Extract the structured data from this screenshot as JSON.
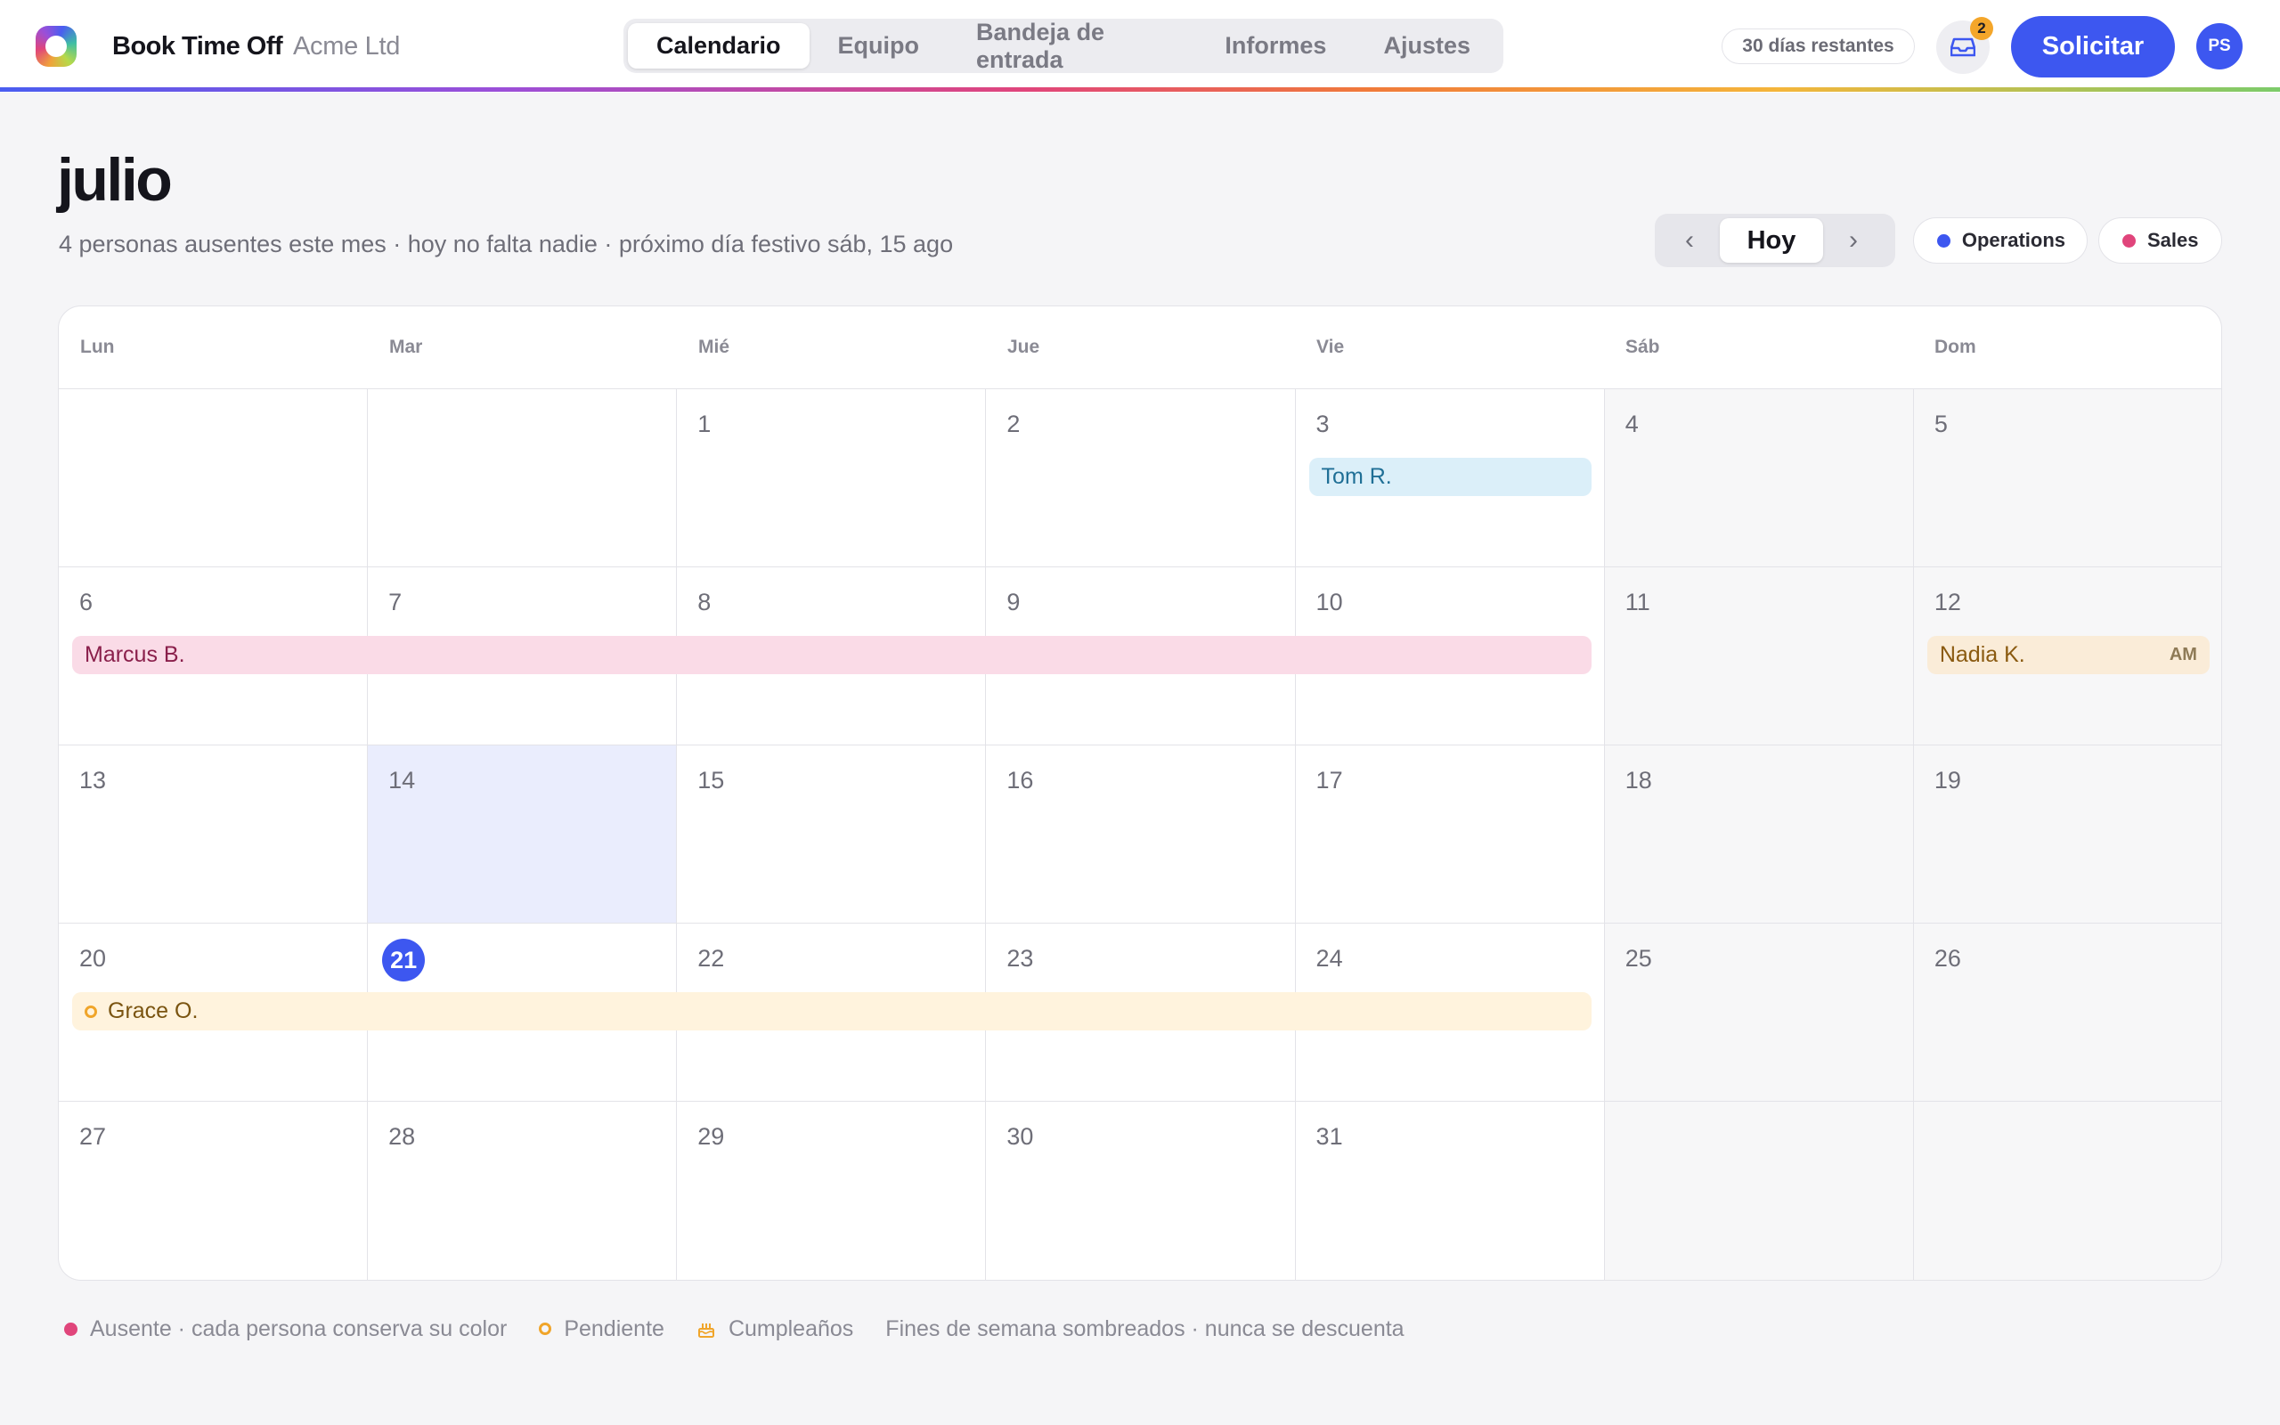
{
  "header": {
    "app_name": "Book Time Off",
    "company": "Acme Ltd",
    "tabs": [
      {
        "label": "Calendario",
        "active": true
      },
      {
        "label": "Equipo",
        "active": false
      },
      {
        "label": "Bandeja de entrada",
        "active": false
      },
      {
        "label": "Informes",
        "active": false
      },
      {
        "label": "Ajustes",
        "active": false
      }
    ],
    "days_left": "30 días restantes",
    "inbox_count": "2",
    "request_label": "Solicitar",
    "avatar_initials": "PS"
  },
  "page": {
    "month": "julio",
    "summary": "4 personas ausentes este mes · hoy no falta nadie · próximo día festivo sáb, 15 ago",
    "prev_icon": "‹",
    "next_icon": "›",
    "today_label": "Hoy",
    "teams": [
      {
        "label": "Operations",
        "color": "#3d57f0"
      },
      {
        "label": "Sales",
        "color": "#e0457b"
      }
    ]
  },
  "calendar": {
    "weekdays": [
      "Lun",
      "Mar",
      "Mié",
      "Jue",
      "Vie",
      "Sáb",
      "Dom"
    ],
    "weeks": [
      [
        "",
        "",
        "1",
        "2",
        "3",
        "4",
        "5"
      ],
      [
        "6",
        "7",
        "8",
        "9",
        "10",
        "11",
        "12"
      ],
      [
        "13",
        "14",
        "15",
        "16",
        "17",
        "18",
        "19"
      ],
      [
        "20",
        "21",
        "22",
        "23",
        "24",
        "25",
        "26"
      ],
      [
        "27",
        "28",
        "29",
        "30",
        "31",
        "",
        ""
      ]
    ],
    "today": "21",
    "selected": "14",
    "events": [
      {
        "name": "Tom R.",
        "start": "3",
        "end": "3",
        "status": "absent",
        "bg": "#dbeff9",
        "fg": "#1f6f96"
      },
      {
        "name": "Marcus B.",
        "start": "6",
        "end": "10",
        "status": "absent",
        "bg": "#fadbe7",
        "fg": "#8a1f4b"
      },
      {
        "name": "Nadia K.",
        "start": "12",
        "end": "12",
        "status": "absent",
        "bg": "#faecd8",
        "fg": "#8a5a10",
        "tag": "AM"
      },
      {
        "name": "Grace O.",
        "start": "20",
        "end": "24",
        "status": "pending",
        "bg": "#fff3dd",
        "fg": "#7a5410"
      }
    ]
  },
  "legend": {
    "absent": "Ausente · cada persona conserva su color",
    "pending": "Pendiente",
    "birthday": "Cumpleaños",
    "weekends": "Fines de semana sombreados · nunca se descuenta"
  },
  "colors": {
    "accent": "#3d57f0",
    "absent": "#e0457b",
    "pending": "#f0a52a"
  }
}
